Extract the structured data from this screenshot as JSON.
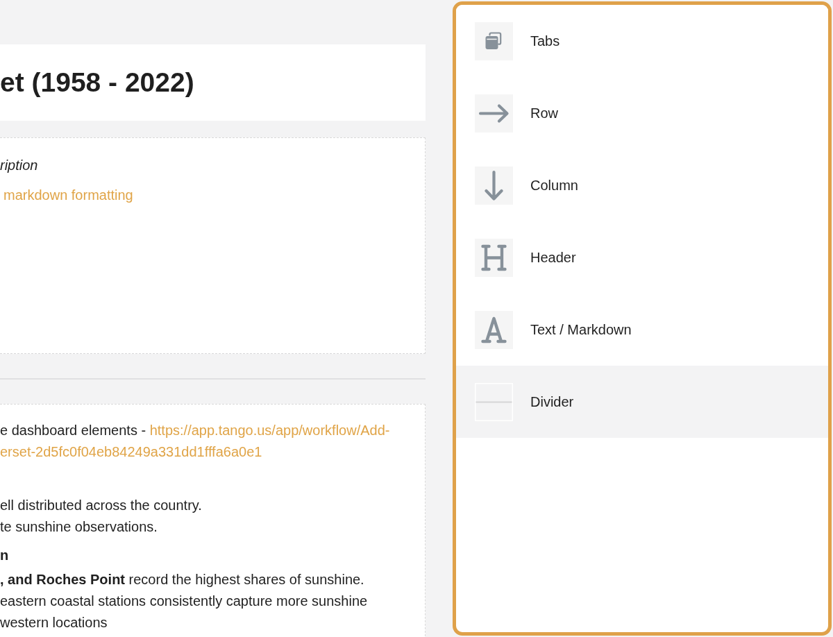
{
  "dashboard": {
    "title": "et (1958 - 2022)",
    "description_card": {
      "title": "ription",
      "link": "markdown formatting"
    },
    "markdown_card": {
      "blocks": [
        {
          "kind": "paragraph",
          "lines": [
            {
              "text": "e dashboard elements - ",
              "link": "https://app.tango.us/app/workflow/Add-"
            },
            {
              "link": "erset-2d5fc0f04eb84249a331dd1fffa6a0e1"
            }
          ]
        },
        {
          "kind": "paragraph",
          "lines": [
            {
              "text": "ell distributed across the country."
            },
            {
              "text": "te sunshine observations."
            }
          ]
        },
        {
          "kind": "heading",
          "lines": [
            {
              "text": "n"
            }
          ]
        },
        {
          "kind": "paragraph",
          "lines": [
            {
              "text": "**, and Roches Point** record the highest shares of sunshine."
            },
            {
              "text": "eastern coastal stations consistently capture more sunshine"
            },
            {
              "text": "western locations"
            }
          ]
        }
      ]
    }
  },
  "component_panel": {
    "items": [
      {
        "label": "Tabs",
        "kind": "tabs",
        "highlighted": false
      },
      {
        "label": "Row",
        "kind": "row",
        "highlighted": false
      },
      {
        "label": "Column",
        "kind": "column",
        "highlighted": false
      },
      {
        "label": "Header",
        "kind": "header",
        "highlighted": false
      },
      {
        "label": "Text / Markdown",
        "kind": "markdown",
        "highlighted": false
      },
      {
        "label": "Divider",
        "kind": "divider",
        "highlighted": true
      }
    ]
  }
}
